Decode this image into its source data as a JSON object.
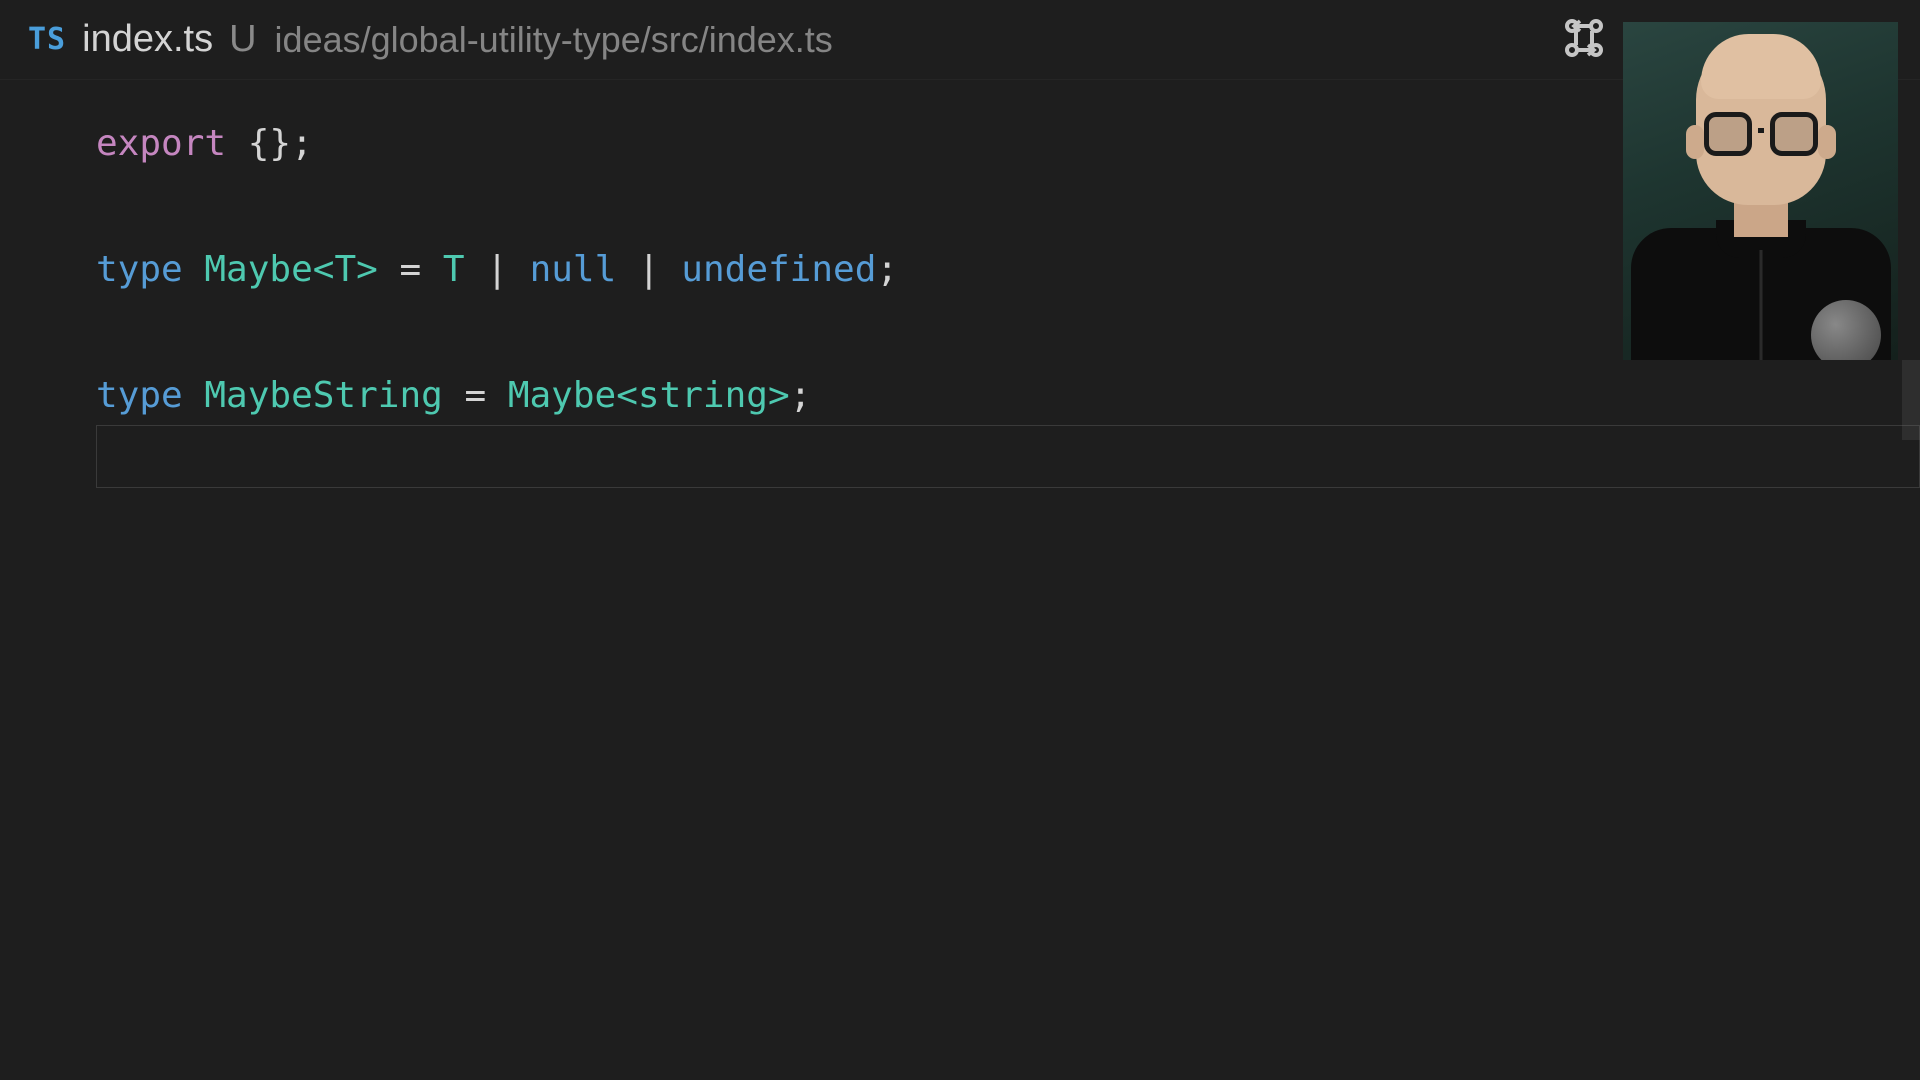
{
  "tab": {
    "language_badge": "TS",
    "filename": "index.ts",
    "vcs_status": "U",
    "path": "ideas/global-utility-type/src/index.ts"
  },
  "code": {
    "line1": {
      "export_kw": "export",
      "braces": " {}",
      "semi": ";"
    },
    "line3": {
      "type_kw": "type",
      "name": " Maybe",
      "generic_open": "<",
      "generic_param": "T",
      "generic_close": ">",
      "equals": " = ",
      "t_ref": "T",
      "pipe1": " | ",
      "null_kw": "null",
      "pipe2": " | ",
      "undefined_kw": "undefined",
      "semi": ";"
    },
    "line5": {
      "type_kw": "type",
      "name": " MaybeString",
      "equals": " = ",
      "maybe_ref": "Maybe",
      "angle_open": "<",
      "string_type": "string",
      "angle_close": ">",
      "semi": ";"
    }
  },
  "cursor_line_top_px": "450"
}
